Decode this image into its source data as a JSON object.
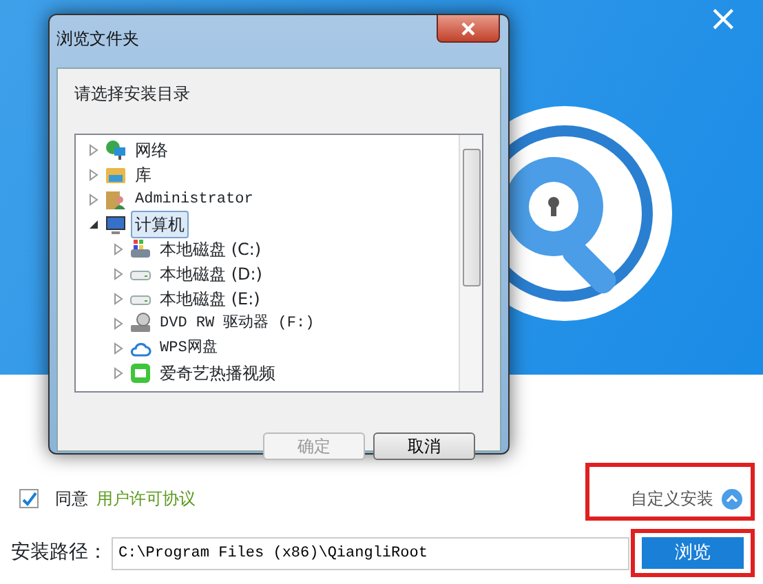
{
  "installer": {
    "close_glyph": "×",
    "agree_checked": true,
    "agree_label": "同意",
    "license_link": "用户许可协议",
    "custom_install": "自定义安装",
    "custom_expanded": true,
    "path_label": "安装路径：",
    "path_value": "C:\\Program Files (x86)\\QiangliRoot",
    "browse_button": "浏览",
    "custom_install_highlighted": true,
    "browse_highlighted": true
  },
  "dialog": {
    "title": "浏览文件夹",
    "prompt": "请选择安装目录",
    "tree": [
      {
        "label": "网络",
        "kind": "network",
        "expanded": false,
        "selected": false
      },
      {
        "label": "库",
        "kind": "library",
        "expanded": false,
        "selected": false
      },
      {
        "label": "Administrator",
        "kind": "user",
        "expanded": false,
        "selected": false
      },
      {
        "label": "计算机",
        "kind": "computer",
        "expanded": true,
        "selected": true,
        "children": [
          {
            "label": "本地磁盘 (C:)",
            "kind": "system-drive",
            "expanded": false,
            "selected": false
          },
          {
            "label": "本地磁盘 (D:)",
            "kind": "drive",
            "expanded": false,
            "selected": false
          },
          {
            "label": "本地磁盘 (E:)",
            "kind": "drive",
            "expanded": false,
            "selected": false
          },
          {
            "label": "DVD RW 驱动器 (F:)",
            "kind": "dvd",
            "expanded": false,
            "selected": false
          },
          {
            "label": "WPS网盘",
            "kind": "cloud",
            "expanded": false,
            "selected": false
          },
          {
            "label": "爱奇艺热播视频",
            "kind": "video",
            "expanded": false,
            "selected": false
          }
        ]
      }
    ],
    "buttons": [
      {
        "label": "确定",
        "disabled": true
      },
      {
        "label": "取消",
        "disabled": false
      }
    ]
  }
}
